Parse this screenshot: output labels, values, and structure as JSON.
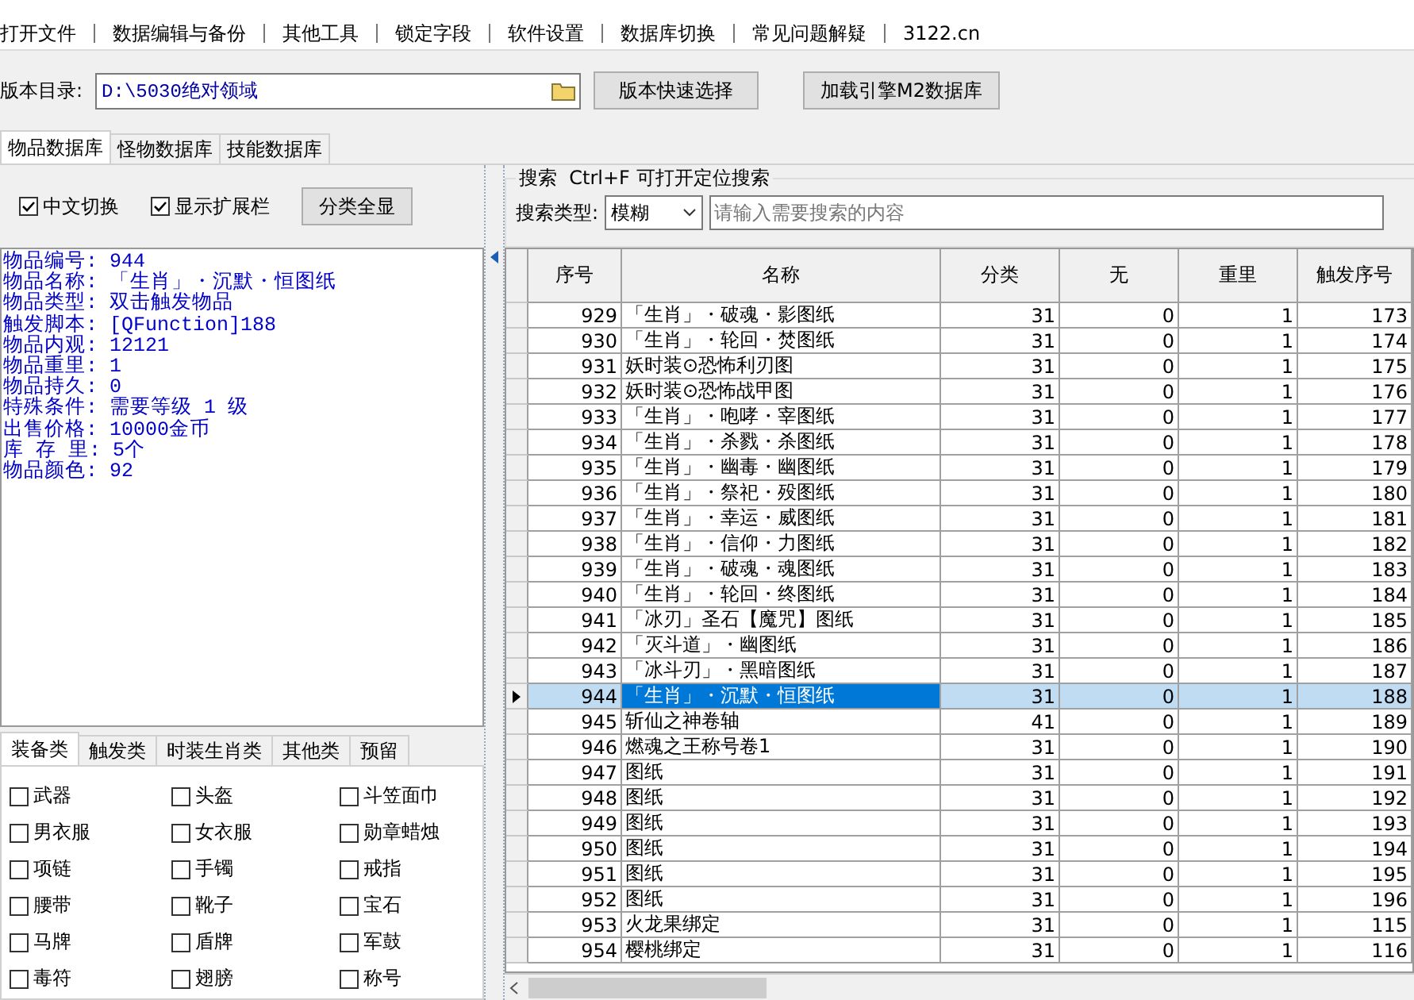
{
  "menu": [
    "打开文件",
    "数据编辑与备份",
    "其他工具",
    "锁定字段",
    "软件设置",
    "数据库切换",
    "常见问题解疑",
    "3122.cn"
  ],
  "version": {
    "label": "版本目录:",
    "path": "D:\\5030绝对领域",
    "buttons": [
      "版本快速选择",
      "加载引擎M2数据库"
    ]
  },
  "db_tabs": [
    {
      "label": "物品数据库",
      "selected": true
    },
    {
      "label": "怪物数据库",
      "selected": false
    },
    {
      "label": "技能数据库",
      "selected": false
    }
  ],
  "options": [
    {
      "label": "中文切换",
      "checked": true
    },
    {
      "label": "显示扩展栏",
      "checked": true
    }
  ],
  "show_all_button": "分类全显",
  "search": {
    "caption": "搜索  Ctrl+F 可打开定位搜索",
    "type_label": "搜索类型:",
    "type_value": "模糊",
    "placeholder": "请输入需要搜索的内容"
  },
  "info_lines": [
    "物品编号: 944",
    "物品名称: 「生肖」・沉默・恒图纸",
    "物品类型: 双击触发物品",
    "触发脚本: [QFunction]188",
    "物品内观: 12121",
    "物品重里: 1",
    "物品持久: 0",
    "特殊条件: 需要等级 1 级",
    "出售价格: 10000金币",
    "库 存 里: 5个",
    "物品颜色: 92"
  ],
  "category_tabs": [
    {
      "label": "装备类",
      "selected": true
    },
    {
      "label": "触发类",
      "selected": false
    },
    {
      "label": "时装生肖类",
      "selected": false
    },
    {
      "label": "其他类",
      "selected": false
    },
    {
      "label": "预留",
      "selected": false
    }
  ],
  "categories": [
    {
      "label": "武器",
      "checked": false
    },
    {
      "label": "头盔",
      "checked": false
    },
    {
      "label": "斗笠面巾",
      "checked": false
    },
    {
      "label": "男衣服",
      "checked": false
    },
    {
      "label": "女衣服",
      "checked": false
    },
    {
      "label": "勋章蜡烛",
      "checked": false
    },
    {
      "label": "项链",
      "checked": false
    },
    {
      "label": "手镯",
      "checked": false
    },
    {
      "label": "戒指",
      "checked": false
    },
    {
      "label": "腰带",
      "checked": false
    },
    {
      "label": "靴子",
      "checked": false
    },
    {
      "label": "宝石",
      "checked": false
    },
    {
      "label": "马牌",
      "checked": false
    },
    {
      "label": "盾牌",
      "checked": false
    },
    {
      "label": "军鼓",
      "checked": false
    },
    {
      "label": "毒符",
      "checked": false
    },
    {
      "label": "翅膀",
      "checked": false
    },
    {
      "label": "称号",
      "checked": false
    }
  ],
  "table": {
    "columns": [
      "序号",
      "名称",
      "分类",
      "无",
      "重里",
      "触发序号"
    ],
    "rows": [
      {
        "cells": [
          "929",
          "「生肖」・破魂・影图纸",
          "31",
          "0",
          "1",
          "173"
        ],
        "selected": false
      },
      {
        "cells": [
          "930",
          "「生肖」・轮回・焚图纸",
          "31",
          "0",
          "1",
          "174"
        ],
        "selected": false
      },
      {
        "cells": [
          "931",
          "妖时装⊙恐怖利刃图",
          "31",
          "0",
          "1",
          "175"
        ],
        "selected": false
      },
      {
        "cells": [
          "932",
          "妖时装⊙恐怖战甲图",
          "31",
          "0",
          "1",
          "176"
        ],
        "selected": false
      },
      {
        "cells": [
          "933",
          "「生肖」・咆哮・宰图纸",
          "31",
          "0",
          "1",
          "177"
        ],
        "selected": false
      },
      {
        "cells": [
          "934",
          "「生肖」・杀戮・杀图纸",
          "31",
          "0",
          "1",
          "178"
        ],
        "selected": false
      },
      {
        "cells": [
          "935",
          "「生肖」・幽毒・幽图纸",
          "31",
          "0",
          "1",
          "179"
        ],
        "selected": false
      },
      {
        "cells": [
          "936",
          "「生肖」・祭祀・殁图纸",
          "31",
          "0",
          "1",
          "180"
        ],
        "selected": false
      },
      {
        "cells": [
          "937",
          "「生肖」・幸运・威图纸",
          "31",
          "0",
          "1",
          "181"
        ],
        "selected": false
      },
      {
        "cells": [
          "938",
          "「生肖」・信仰・力图纸",
          "31",
          "0",
          "1",
          "182"
        ],
        "selected": false
      },
      {
        "cells": [
          "939",
          "「生肖」・破魂・魂图纸",
          "31",
          "0",
          "1",
          "183"
        ],
        "selected": false
      },
      {
        "cells": [
          "940",
          "「生肖」・轮回・终图纸",
          "31",
          "0",
          "1",
          "184"
        ],
        "selected": false
      },
      {
        "cells": [
          "941",
          "「冰刃」圣石【魔咒】图纸",
          "31",
          "0",
          "1",
          "185"
        ],
        "selected": false
      },
      {
        "cells": [
          "942",
          "「灭斗道」・幽图纸",
          "31",
          "0",
          "1",
          "186"
        ],
        "selected": false
      },
      {
        "cells": [
          "943",
          "「冰斗刃」・黑暗图纸",
          "31",
          "0",
          "1",
          "187"
        ],
        "selected": false
      },
      {
        "cells": [
          "944",
          "「生肖」・沉默・恒图纸",
          "31",
          "0",
          "1",
          "188"
        ],
        "selected": true
      },
      {
        "cells": [
          "945",
          "斩仙之神卷轴",
          "41",
          "0",
          "1",
          "189"
        ],
        "selected": false
      },
      {
        "cells": [
          "946",
          "燃魂之王称号卷1",
          "31",
          "0",
          "1",
          "190"
        ],
        "selected": false
      },
      {
        "cells": [
          "947",
          "图纸",
          "31",
          "0",
          "1",
          "191"
        ],
        "selected": false
      },
      {
        "cells": [
          "948",
          "图纸",
          "31",
          "0",
          "1",
          "192"
        ],
        "selected": false
      },
      {
        "cells": [
          "949",
          "图纸",
          "31",
          "0",
          "1",
          "193"
        ],
        "selected": false
      },
      {
        "cells": [
          "950",
          "图纸",
          "31",
          "0",
          "1",
          "194"
        ],
        "selected": false
      },
      {
        "cells": [
          "951",
          "图纸",
          "31",
          "0",
          "1",
          "195"
        ],
        "selected": false
      },
      {
        "cells": [
          "952",
          "图纸",
          "31",
          "0",
          "1",
          "196"
        ],
        "selected": false
      },
      {
        "cells": [
          "953",
          "火龙果绑定",
          "31",
          "0",
          "1",
          "115"
        ],
        "selected": false
      },
      {
        "cells": [
          "954",
          "樱桃绑定",
          "31",
          "0",
          "1",
          "116"
        ],
        "selected": false
      }
    ]
  }
}
